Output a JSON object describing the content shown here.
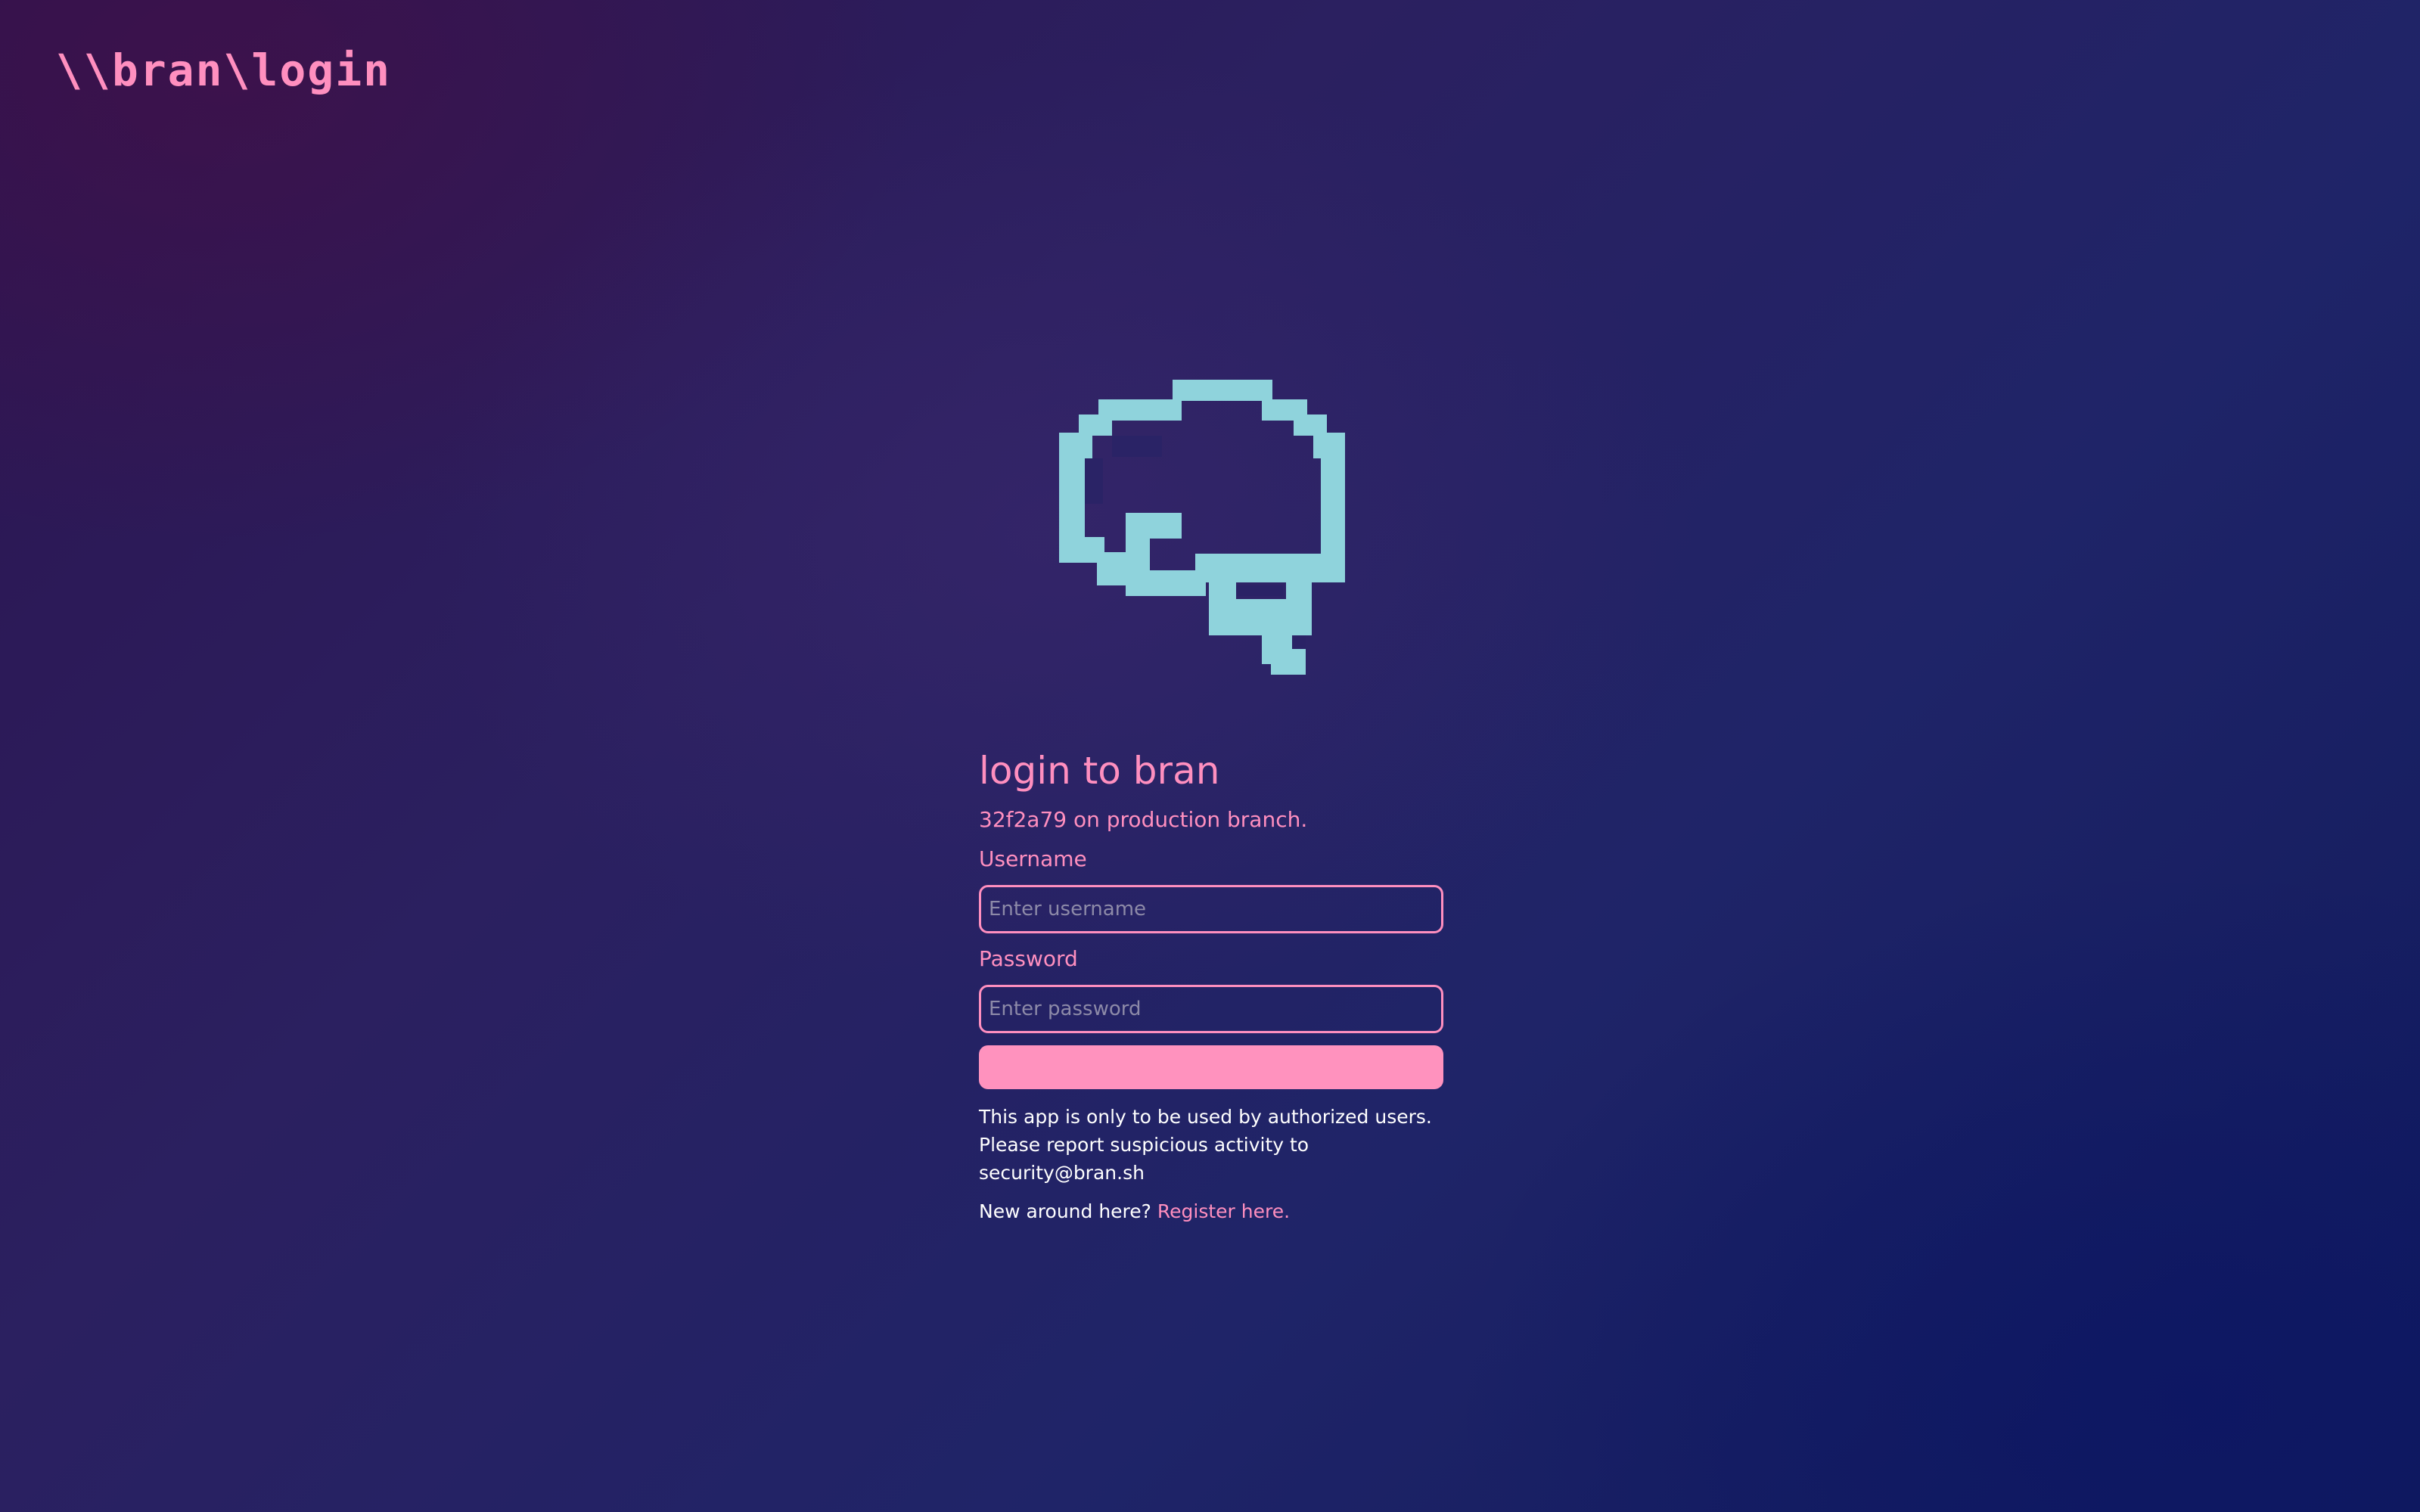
{
  "header": {
    "logo_text": "\\\\bran\\login"
  },
  "brand_icon": {
    "name": "brain-icon",
    "color": "#8fd3dc"
  },
  "login": {
    "title": "login to bran",
    "commit_info": "32f2a79 on production branch.",
    "username_label": "Username",
    "username_placeholder": "Enter username",
    "username_value": "",
    "password_label": "Password",
    "password_placeholder": "Enter password",
    "password_value": "",
    "submit_label": "",
    "notice": "This app is only to be used by authorized users. Please report suspicious activity to security@bran.sh",
    "register_prompt": "New around here?",
    "register_link": "Register here."
  },
  "colors": {
    "accent": "#ff8fbf",
    "button": "#ff92be",
    "icon": "#8fd3dc",
    "text": "#ffffff",
    "background_start": "#2d1450",
    "background_end": "#101a5c"
  }
}
